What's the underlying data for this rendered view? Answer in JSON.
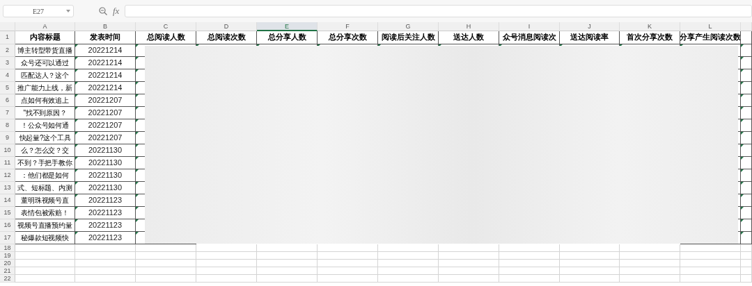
{
  "name_box": {
    "value": "E27"
  },
  "formula_bar": {
    "label": "fx"
  },
  "columns": [
    {
      "letter": "A",
      "selected": false
    },
    {
      "letter": "B",
      "selected": false
    },
    {
      "letter": "C",
      "selected": false
    },
    {
      "letter": "D",
      "selected": false
    },
    {
      "letter": "E",
      "selected": true
    },
    {
      "letter": "F",
      "selected": false
    },
    {
      "letter": "G",
      "selected": false
    },
    {
      "letter": "H",
      "selected": false
    },
    {
      "letter": "I",
      "selected": false
    },
    {
      "letter": "J",
      "selected": false
    },
    {
      "letter": "K",
      "selected": false
    },
    {
      "letter": "L",
      "selected": false
    }
  ],
  "header_row": {
    "number": "1",
    "cells": [
      "内容标题",
      "发表时间",
      "总阅读人数",
      "总阅读次数",
      "总分享人数",
      "总分享次数",
      "阅读后关注人数",
      "送达人数",
      "众号消息阅读次",
      "送达阅读率",
      "首次分享次数",
      "分享产生阅读次数"
    ]
  },
  "rows": [
    {
      "number": "2",
      "title": "博主转型带货直播",
      "date": "20221214"
    },
    {
      "number": "3",
      "title": "众号还可以通过",
      "date": "20221214"
    },
    {
      "number": "4",
      "title": "匹配达人？这个",
      "date": "20221214"
    },
    {
      "number": "5",
      "title": "推广能力上线，新",
      "date": "20221214"
    },
    {
      "number": "6",
      "title": "点如何有效追上",
      "date": "20221207"
    },
    {
      "number": "7",
      "title": "\"找不到原因？",
      "date": "20221207"
    },
    {
      "number": "8",
      "title": "！公众号如何通",
      "date": "20221207"
    },
    {
      "number": "9",
      "title": "快起量?这个工具",
      "date": "20221207"
    },
    {
      "number": "10",
      "title": "么？怎么交？交",
      "date": "20221130"
    },
    {
      "number": "11",
      "title": "不到？手把手教你",
      "date": "20221130"
    },
    {
      "number": "12",
      "title": "：他们都是如何",
      "date": "20221130"
    },
    {
      "number": "13",
      "title": "式、短标题、内测",
      "date": "20221130"
    },
    {
      "number": "14",
      "title": "董明珠视频号直",
      "date": "20221123"
    },
    {
      "number": "15",
      "title": "表情包被索赔！",
      "date": "20221123"
    },
    {
      "number": "16",
      "title": "视频号直播预约量",
      "date": "20221123"
    },
    {
      "number": "17",
      "title": "秘爆款短视频快",
      "date": "20221123"
    }
  ],
  "empty_rows": [
    "18",
    "19",
    "20",
    "21",
    "22"
  ]
}
